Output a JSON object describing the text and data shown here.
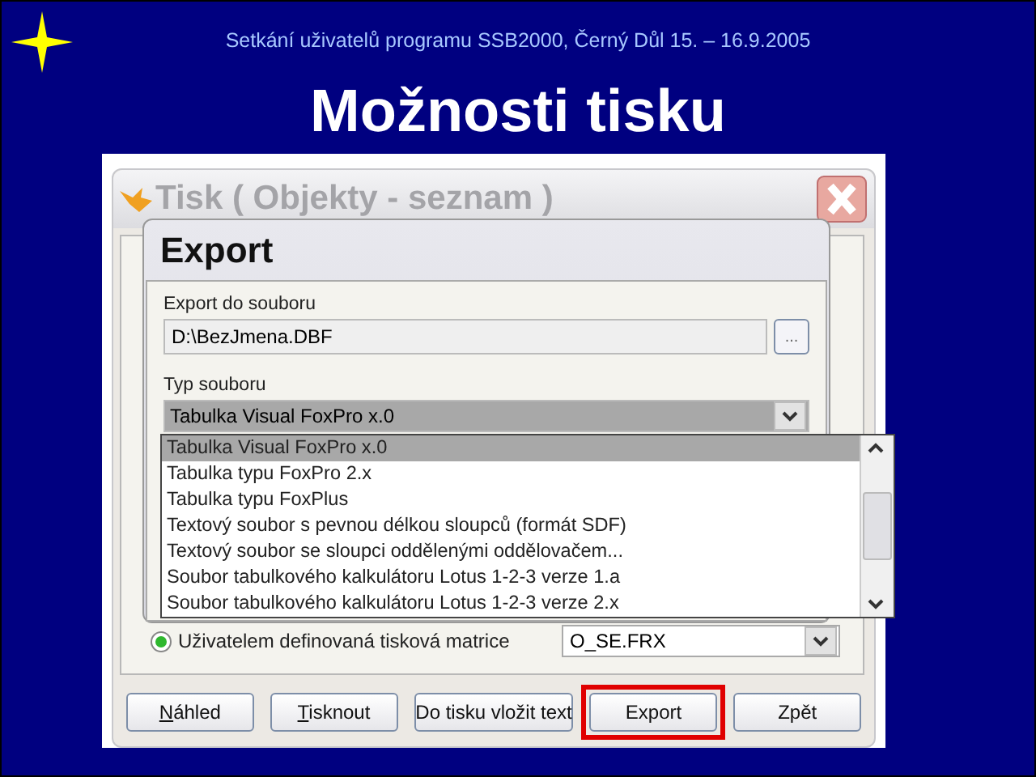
{
  "slide": {
    "header": "Setkání uživatelů programu SSB2000, Černý Důl 15. – 16.9.2005",
    "title": "Možnosti tisku"
  },
  "print_dialog": {
    "title": "Tisk ( Objekty - seznam )",
    "radio": {
      "label": "Uživatelem definovaná tisková matrice",
      "selected": true
    },
    "matrix_combo": {
      "value": "O_SE.FRX"
    },
    "buttons": [
      {
        "label": "Náhled",
        "underline_first": true,
        "highlighted": false
      },
      {
        "label": "Tisknout",
        "underline_first": true,
        "highlighted": false
      },
      {
        "label": "Do tisku vložit text",
        "underline_first": false,
        "highlighted": false
      },
      {
        "label": "Export",
        "underline_first": false,
        "highlighted": true
      },
      {
        "label": "Zpět",
        "underline_first": false,
        "highlighted": false
      }
    ]
  },
  "export_dialog": {
    "title": "Export",
    "file_label": "Export do souboru",
    "file_value": "D:\\BezJmena.DBF",
    "browse_button": "...",
    "type_label": "Typ souboru",
    "type_value": "Tabulka Visual FoxPro x.0",
    "options": [
      {
        "label": "Tabulka Visual FoxPro x.0",
        "selected": true
      },
      {
        "label": "Tabulka typu FoxPro 2.x",
        "selected": false
      },
      {
        "label": "Tabulka typu FoxPlus",
        "selected": false
      },
      {
        "label": "Textový soubor s pevnou délkou sloupců (formát SDF)",
        "selected": false
      },
      {
        "label": "Textový soubor se sloupci oddělenými oddělovačem...",
        "selected": false
      },
      {
        "label": "Soubor tabulkového kalkulátoru Lotus 1-2-3 verze 1.a",
        "selected": false
      },
      {
        "label": "Soubor tabulkového kalkulátoru Lotus 1-2-3 verze 2.x",
        "selected": false
      }
    ]
  }
}
